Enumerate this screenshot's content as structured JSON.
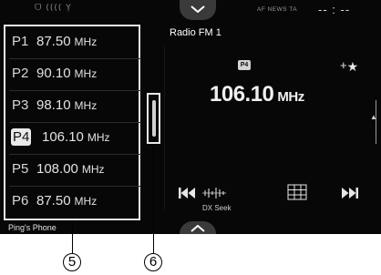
{
  "status": {
    "left_icons": "ᗜ (((( Ỵ",
    "af_news_ta": "AF  NEWS  TA",
    "clock": "-- : --"
  },
  "band": "Radio FM 1",
  "presets": [
    {
      "num": "P1",
      "freq": "87.50",
      "unit": "MHz"
    },
    {
      "num": "P2",
      "freq": "90.10",
      "unit": "MHz"
    },
    {
      "num": "P3",
      "freq": "98.10",
      "unit": "MHz"
    },
    {
      "num": "P4",
      "freq": "106.10",
      "unit": "MHz",
      "active": true
    },
    {
      "num": "P5",
      "freq": "108.00",
      "unit": "MHz"
    },
    {
      "num": "P6",
      "freq": "87.50",
      "unit": "MHz"
    }
  ],
  "phone_label": "Ping's Phone",
  "current": {
    "preset_badge": "P4",
    "freq": "106.10",
    "unit": "MHz",
    "favorite_plus": "+",
    "favorite_star": "★"
  },
  "controls": {
    "prev": "⏮",
    "next": "⏭",
    "dx_seek_label": "DX Seek"
  },
  "callouts": {
    "five": "5",
    "six": "6"
  },
  "icons": [
    "chevron-up-icon",
    "chevron-down-icon",
    "bluetooth-icon",
    "battery-icon",
    "signal-icon",
    "star-icon",
    "skip-back-icon",
    "skip-forward-icon",
    "dx-seek-icon",
    "preset-grid-icon"
  ]
}
